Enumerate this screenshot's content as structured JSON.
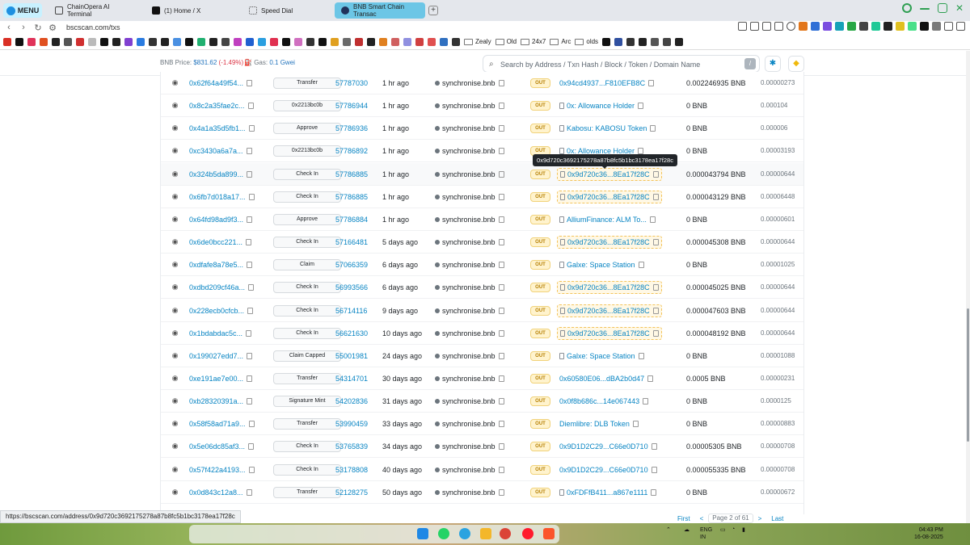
{
  "browser": {
    "menu_label": "MENU",
    "tabs": [
      {
        "label": "ChainOpera AI Terminal",
        "icon": "terminal-icon"
      },
      {
        "label": "(1) Home / X",
        "icon": "x-logo-icon"
      },
      {
        "label": "Speed Dial",
        "icon": "grid-icon"
      },
      {
        "label": "BNB Smart Chain Transac",
        "icon": "bscscan-logo-icon",
        "active": true
      }
    ],
    "url": "bscscan.com/txs",
    "bookmark_folders": [
      "Zealy",
      "Old",
      "24x7",
      "Arc",
      "olds"
    ],
    "status_url": "https://bscscan.com/address/0x9d720c3692175278a87b8fc5b1bc3178ea17f28c"
  },
  "header": {
    "bnb_price_label": "BNB Price:",
    "bnb_price_value": "$831.62",
    "bnb_price_change": "(-1.49%)",
    "gas_label": "Gas:",
    "gas_value": "0.1 Gwei",
    "search_placeholder": "Search by Address / Txn Hash / Block / Token / Domain Name",
    "search_shortcut": "/"
  },
  "tooltip": "0x9d720c3692175278a87b8fc5b1bc3178ea17f28c",
  "transactions": [
    {
      "hash": "0x62f64a49f54...",
      "method": "Transfer",
      "block": "57787030",
      "age": "1 hr ago",
      "from": "synchronise.bnb",
      "direction": "OUT",
      "to": "0x94cd4937...F810EFB8C",
      "to_is_contract": false,
      "amount": "0.002246935 BNB",
      "fee": "0.00000273"
    },
    {
      "hash": "0x8c2a35fae2c...",
      "method": "0x2213bc0b",
      "block": "57786944",
      "age": "1 hr ago",
      "from": "synchronise.bnb",
      "direction": "OUT",
      "to": "0x: Allowance Holder",
      "to_is_contract": true,
      "amount": "0 BNB",
      "fee": "0.000104"
    },
    {
      "hash": "0x4a1a35d5fb1...",
      "method": "Approve",
      "block": "57786936",
      "age": "1 hr ago",
      "from": "synchronise.bnb",
      "direction": "OUT",
      "to": "Kabosu: KABOSU Token",
      "to_is_contract": true,
      "amount": "0 BNB",
      "fee": "0.000006"
    },
    {
      "hash": "0xc3430a6a7a...",
      "method": "0x2213bc0b",
      "block": "57786892",
      "age": "1 hr ago",
      "from": "synchronise.bnb",
      "direction": "OUT",
      "to": "0x: Allowance Holder",
      "to_is_contract": true,
      "amount": "0 BNB",
      "fee": "0.00003193"
    },
    {
      "hash": "0x324b5da899...",
      "method": "Check In",
      "block": "57786885",
      "age": "1 hr ago",
      "from": "synchronise.bnb",
      "direction": "OUT",
      "to": "0x9d720c36...8Ea17f28C",
      "to_is_contract": true,
      "highlight": true,
      "amount": "0.000043794 BNB",
      "fee": "0.00000644"
    },
    {
      "hash": "0x6fb7d018a17...",
      "method": "Check In",
      "block": "57786885",
      "age": "1 hr ago",
      "from": "synchronise.bnb",
      "direction": "OUT",
      "to": "0x9d720c36...8Ea17f28C",
      "to_is_contract": true,
      "highlight": true,
      "amount": "0.000043129 BNB",
      "fee": "0.00006448"
    },
    {
      "hash": "0x64fd98ad9f3...",
      "method": "Approve",
      "block": "57786884",
      "age": "1 hr ago",
      "from": "synchronise.bnb",
      "direction": "OUT",
      "to": "AlliumFinance: ALM To...",
      "to_is_contract": true,
      "amount": "0 BNB",
      "fee": "0.00000601"
    },
    {
      "hash": "0x6de0bcc221...",
      "method": "Check In",
      "block": "57166481",
      "age": "5 days ago",
      "from": "synchronise.bnb",
      "direction": "OUT",
      "to": "0x9d720c36...8Ea17f28C",
      "to_is_contract": true,
      "highlight": true,
      "amount": "0.000045308 BNB",
      "fee": "0.00000644"
    },
    {
      "hash": "0xdfafe8a78e5...",
      "method": "Claim",
      "block": "57066359",
      "age": "6 days ago",
      "from": "synchronise.bnb",
      "direction": "OUT",
      "to": "Galxe: Space Station",
      "to_is_contract": true,
      "amount": "0 BNB",
      "fee": "0.00001025"
    },
    {
      "hash": "0xdbd209cf46a...",
      "method": "Check In",
      "block": "56993566",
      "age": "6 days ago",
      "from": "synchronise.bnb",
      "direction": "OUT",
      "to": "0x9d720c36...8Ea17f28C",
      "to_is_contract": true,
      "highlight": true,
      "amount": "0.000045025 BNB",
      "fee": "0.00000644"
    },
    {
      "hash": "0x228ecb0cfcb...",
      "method": "Check In",
      "block": "56714116",
      "age": "9 days ago",
      "from": "synchronise.bnb",
      "direction": "OUT",
      "to": "0x9d720c36...8Ea17f28C",
      "to_is_contract": true,
      "highlight": true,
      "amount": "0.000047603 BNB",
      "fee": "0.00000644"
    },
    {
      "hash": "0x1bdabdac5c...",
      "method": "Check In",
      "block": "56621630",
      "age": "10 days ago",
      "from": "synchronise.bnb",
      "direction": "OUT",
      "to": "0x9d720c36...8Ea17f28C",
      "to_is_contract": true,
      "highlight": true,
      "amount": "0.000048192 BNB",
      "fee": "0.00000644"
    },
    {
      "hash": "0x199027edd7...",
      "method": "Claim Capped",
      "block": "55001981",
      "age": "24 days ago",
      "from": "synchronise.bnb",
      "direction": "OUT",
      "to": "Galxe: Space Station",
      "to_is_contract": true,
      "amount": "0 BNB",
      "fee": "0.00001088"
    },
    {
      "hash": "0xe191ae7e00...",
      "method": "Transfer",
      "block": "54314701",
      "age": "30 days ago",
      "from": "synchronise.bnb",
      "direction": "OUT",
      "to": "0x60580E06...dBA2b0d47",
      "to_is_contract": false,
      "amount": "0.0005 BNB",
      "fee": "0.00000231"
    },
    {
      "hash": "0xb28320391a...",
      "method": "Signature Mint",
      "block": "54202836",
      "age": "31 days ago",
      "from": "synchronise.bnb",
      "direction": "OUT",
      "to": "0x0f8b686c...14e067443",
      "to_is_contract": false,
      "amount": "0 BNB",
      "fee": "0.0000125"
    },
    {
      "hash": "0x58f58ad71a9...",
      "method": "Transfer",
      "block": "53990459",
      "age": "33 days ago",
      "from": "synchronise.bnb",
      "direction": "OUT",
      "to": "Diemlibre: DLB Token",
      "to_is_contract": false,
      "amount": "0 BNB",
      "fee": "0.00000883"
    },
    {
      "hash": "0x5e06dc85af3...",
      "method": "Check In",
      "block": "53765839",
      "age": "34 days ago",
      "from": "synchronise.bnb",
      "direction": "OUT",
      "to": "0x9D1D2C29...C66e0D710",
      "to_is_contract": false,
      "amount": "0.00005305 BNB",
      "fee": "0.00000708"
    },
    {
      "hash": "0x57f422a4193...",
      "method": "Check In",
      "block": "53178808",
      "age": "40 days ago",
      "from": "synchronise.bnb",
      "direction": "OUT",
      "to": "0x9D1D2C29...C66e0D710",
      "to_is_contract": false,
      "amount": "0.000055335 BNB",
      "fee": "0.00000708"
    },
    {
      "hash": "0x0d843c12a8...",
      "method": "Transfer",
      "block": "52128275",
      "age": "50 days ago",
      "from": "synchronise.bnb",
      "direction": "OUT",
      "to": "0xFDFfB411...a867e1111",
      "to_is_contract": true,
      "amount": "0 BNB",
      "fee": "0.00000672"
    }
  ],
  "pagination": {
    "first": "First",
    "prev": "<",
    "page_label": "Page 2 of 61",
    "next": ">",
    "last": "Last"
  },
  "taskbar": {
    "language": "ENG",
    "region": "IN",
    "time": "04:43 PM",
    "date": "16-08-2025"
  }
}
